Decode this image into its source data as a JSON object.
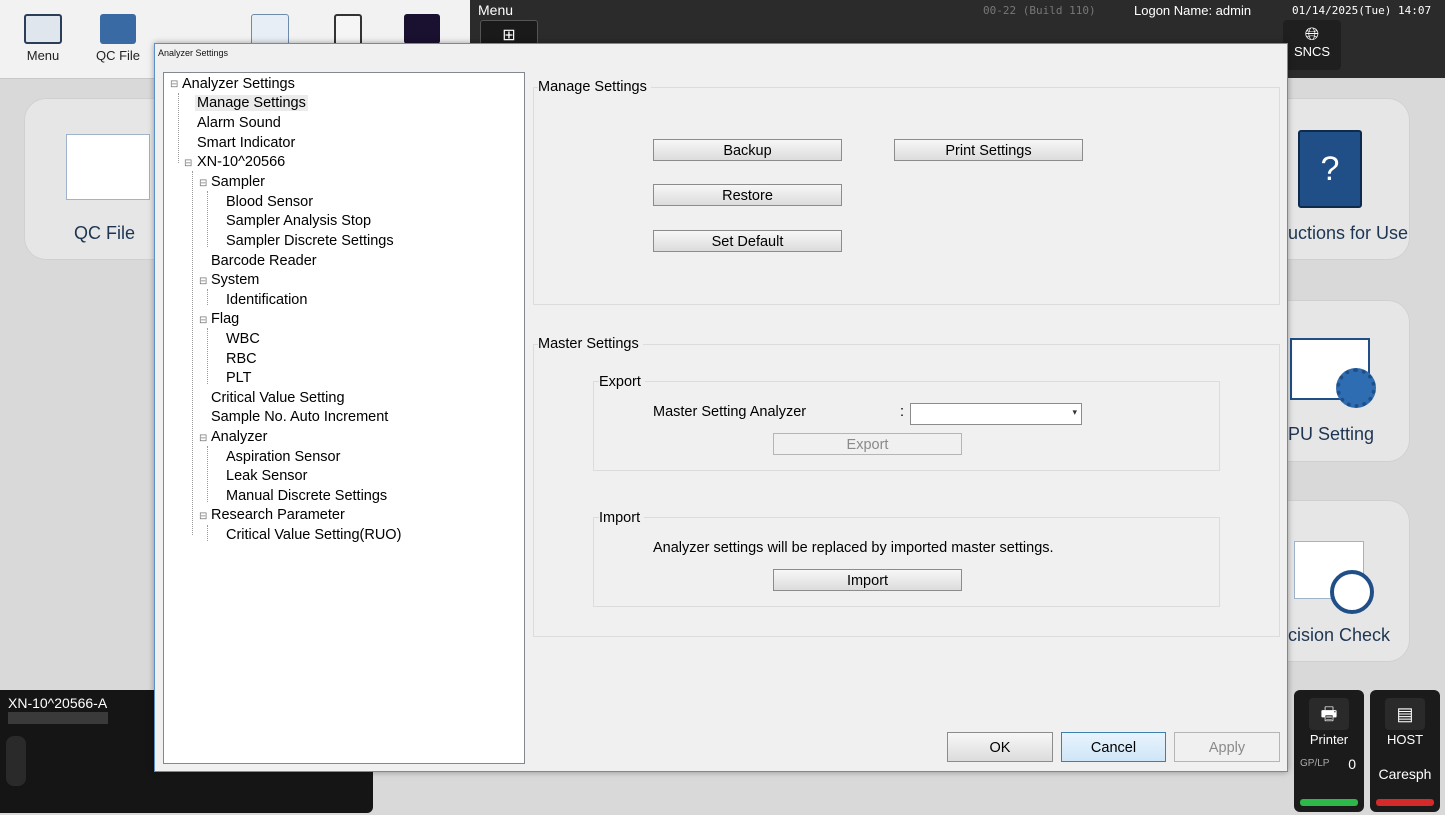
{
  "toolbar": {
    "menu_label": "Menu",
    "qcfile_label": "QC File",
    "dark_menu_label": "Menu",
    "build": "00-22 (Build 110)",
    "logon": "Logon Name: admin",
    "datetime": "01/14/2025(Tue) 14:07",
    "sncs_label": "SNCS"
  },
  "tiles": {
    "qc_file": "QC File",
    "instructions": "uctions for Use",
    "ipu_setting": "PU Setting",
    "precision_check": "cision Check",
    "book_glyph": "?"
  },
  "analyzer": {
    "name": "XN-10^20566-A"
  },
  "status": {
    "printer_label": "Printer",
    "gplp_label": "GP/LP",
    "gplp_count": "0",
    "host_label": "HOST",
    "host_value": "Caresph",
    "printer_color": "#2fb84a",
    "host_color": "#d42a2a"
  },
  "dialog": {
    "title": "Analyzer Settings",
    "tree": {
      "root": "Analyzer Settings",
      "manage": "Manage Settings",
      "alarm": "Alarm Sound",
      "smart": "Smart Indicator",
      "device": "XN-10^20566",
      "sampler": "Sampler",
      "blood_sensor": "Blood Sensor",
      "sampler_stop": "Sampler Analysis Stop",
      "sampler_discrete": "Sampler Discrete Settings",
      "barcode": "Barcode Reader",
      "system": "System",
      "identification": "Identification",
      "flag": "Flag",
      "wbc": "WBC",
      "rbc": "RBC",
      "plt": "PLT",
      "critical": "Critical Value Setting",
      "autoinc": "Sample No. Auto Increment",
      "analyzer": "Analyzer",
      "aspiration": "Aspiration Sensor",
      "leak": "Leak Sensor",
      "manual_discrete": "Manual Discrete Settings",
      "research": "Research Parameter",
      "critical_ruo": "Critical Value Setting(RUO)"
    },
    "manage": {
      "title": "Manage Settings",
      "backup": "Backup",
      "print": "Print Settings",
      "restore": "Restore",
      "set_default": "Set Default"
    },
    "master": {
      "title": "Master Settings",
      "export_title": "Export",
      "analyzer_label": "Master Setting Analyzer",
      "colon": ":",
      "analyzer_value": "",
      "export_button": "Export",
      "import_title": "Import",
      "import_note": "Analyzer settings will be replaced by imported master settings.",
      "import_button": "Import"
    },
    "footer": {
      "ok": "OK",
      "cancel": "Cancel",
      "apply": "Apply"
    }
  }
}
